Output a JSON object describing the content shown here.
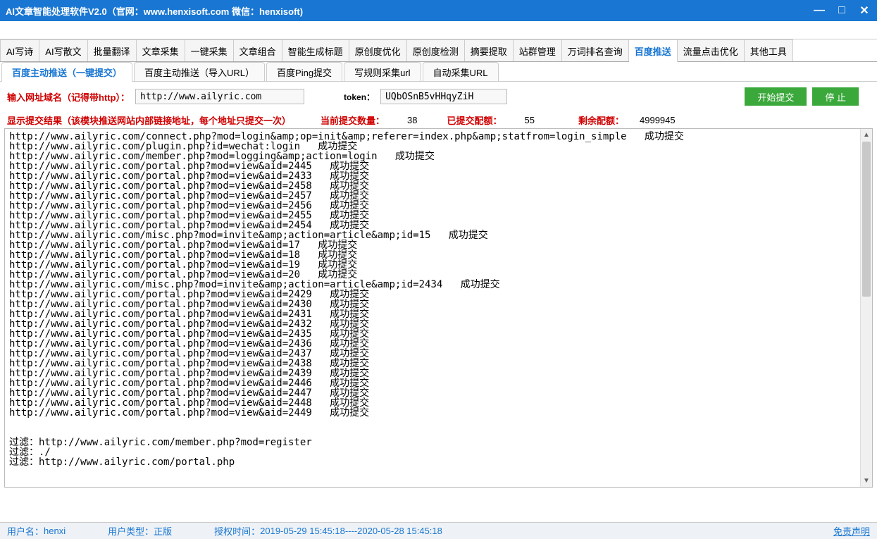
{
  "title": "AI文章智能处理软件V2.0（官网：www.henxisoft.com  微信：henxisoft)",
  "mainTabs": [
    "AI写诗",
    "AI写散文",
    "批量翻译",
    "文章采集",
    "一键采集",
    "文章组合",
    "智能生成标题",
    "原创度优化",
    "原创度检测",
    "摘要提取",
    "站群管理",
    "万词排名查询",
    "百度推送",
    "流量点击优化",
    "其他工具"
  ],
  "mainTabActive": 12,
  "subTabs": [
    "百度主动推送（一键提交）",
    "百度主动推送（导入URL）",
    "百度Ping提交",
    "写规则采集url",
    "自动采集URL"
  ],
  "subTabActive": 0,
  "input": {
    "domainLabel": "输入网址域名（记得带http）：",
    "domainValue": "http://www.ailyric.com",
    "tokenLabel": "token：",
    "tokenValue": "UQbOSnB5vHHqyZiH",
    "startBtn": "开始提交",
    "stopBtn": "停  止"
  },
  "resultHeader": {
    "label": "显示提交结果（该模块推送网站内部链接地址，每个地址只提交一次）",
    "currentLabel": "当前提交数量：",
    "currentValue": "38",
    "submittedLabel": "已提交配额：",
    "submittedValue": "55",
    "remainLabel": "剩余配额：",
    "remainValue": "4999945"
  },
  "logLines": [
    "http://www.ailyric.com/connect.php?mod=login&amp;op=init&amp;referer=index.php&amp;statfrom=login_simple   成功提交",
    "http://www.ailyric.com/plugin.php?id=wechat:login   成功提交",
    "http://www.ailyric.com/member.php?mod=logging&amp;action=login   成功提交",
    "http://www.ailyric.com/portal.php?mod=view&aid=2445   成功提交",
    "http://www.ailyric.com/portal.php?mod=view&aid=2433   成功提交",
    "http://www.ailyric.com/portal.php?mod=view&aid=2458   成功提交",
    "http://www.ailyric.com/portal.php?mod=view&aid=2457   成功提交",
    "http://www.ailyric.com/portal.php?mod=view&aid=2456   成功提交",
    "http://www.ailyric.com/portal.php?mod=view&aid=2455   成功提交",
    "http://www.ailyric.com/portal.php?mod=view&aid=2454   成功提交",
    "http://www.ailyric.com/misc.php?mod=invite&amp;action=article&amp;id=15   成功提交",
    "http://www.ailyric.com/portal.php?mod=view&aid=17   成功提交",
    "http://www.ailyric.com/portal.php?mod=view&aid=18   成功提交",
    "http://www.ailyric.com/portal.php?mod=view&aid=19   成功提交",
    "http://www.ailyric.com/portal.php?mod=view&aid=20   成功提交",
    "http://www.ailyric.com/misc.php?mod=invite&amp;action=article&amp;id=2434   成功提交",
    "http://www.ailyric.com/portal.php?mod=view&aid=2429   成功提交",
    "http://www.ailyric.com/portal.php?mod=view&aid=2430   成功提交",
    "http://www.ailyric.com/portal.php?mod=view&aid=2431   成功提交",
    "http://www.ailyric.com/portal.php?mod=view&aid=2432   成功提交",
    "http://www.ailyric.com/portal.php?mod=view&aid=2435   成功提交",
    "http://www.ailyric.com/portal.php?mod=view&aid=2436   成功提交",
    "http://www.ailyric.com/portal.php?mod=view&aid=2437   成功提交",
    "http://www.ailyric.com/portal.php?mod=view&aid=2438   成功提交",
    "http://www.ailyric.com/portal.php?mod=view&aid=2439   成功提交",
    "http://www.ailyric.com/portal.php?mod=view&aid=2446   成功提交",
    "http://www.ailyric.com/portal.php?mod=view&aid=2447   成功提交",
    "http://www.ailyric.com/portal.php?mod=view&aid=2448   成功提交",
    "http://www.ailyric.com/portal.php?mod=view&aid=2449   成功提交",
    "",
    "",
    "过滤：http://www.ailyric.com/member.php?mod=register",
    "过滤：./",
    "过滤：http://www.ailyric.com/portal.php"
  ],
  "status": {
    "userLabel": "用户名：",
    "userValue": "henxi",
    "typeLabel": "用户类型：",
    "typeValue": "正版",
    "authLabel": "授权时间：",
    "authValue": "2019-05-29 15:45:18----2020-05-28 15:45:18",
    "disclaimer": "免责声明"
  }
}
